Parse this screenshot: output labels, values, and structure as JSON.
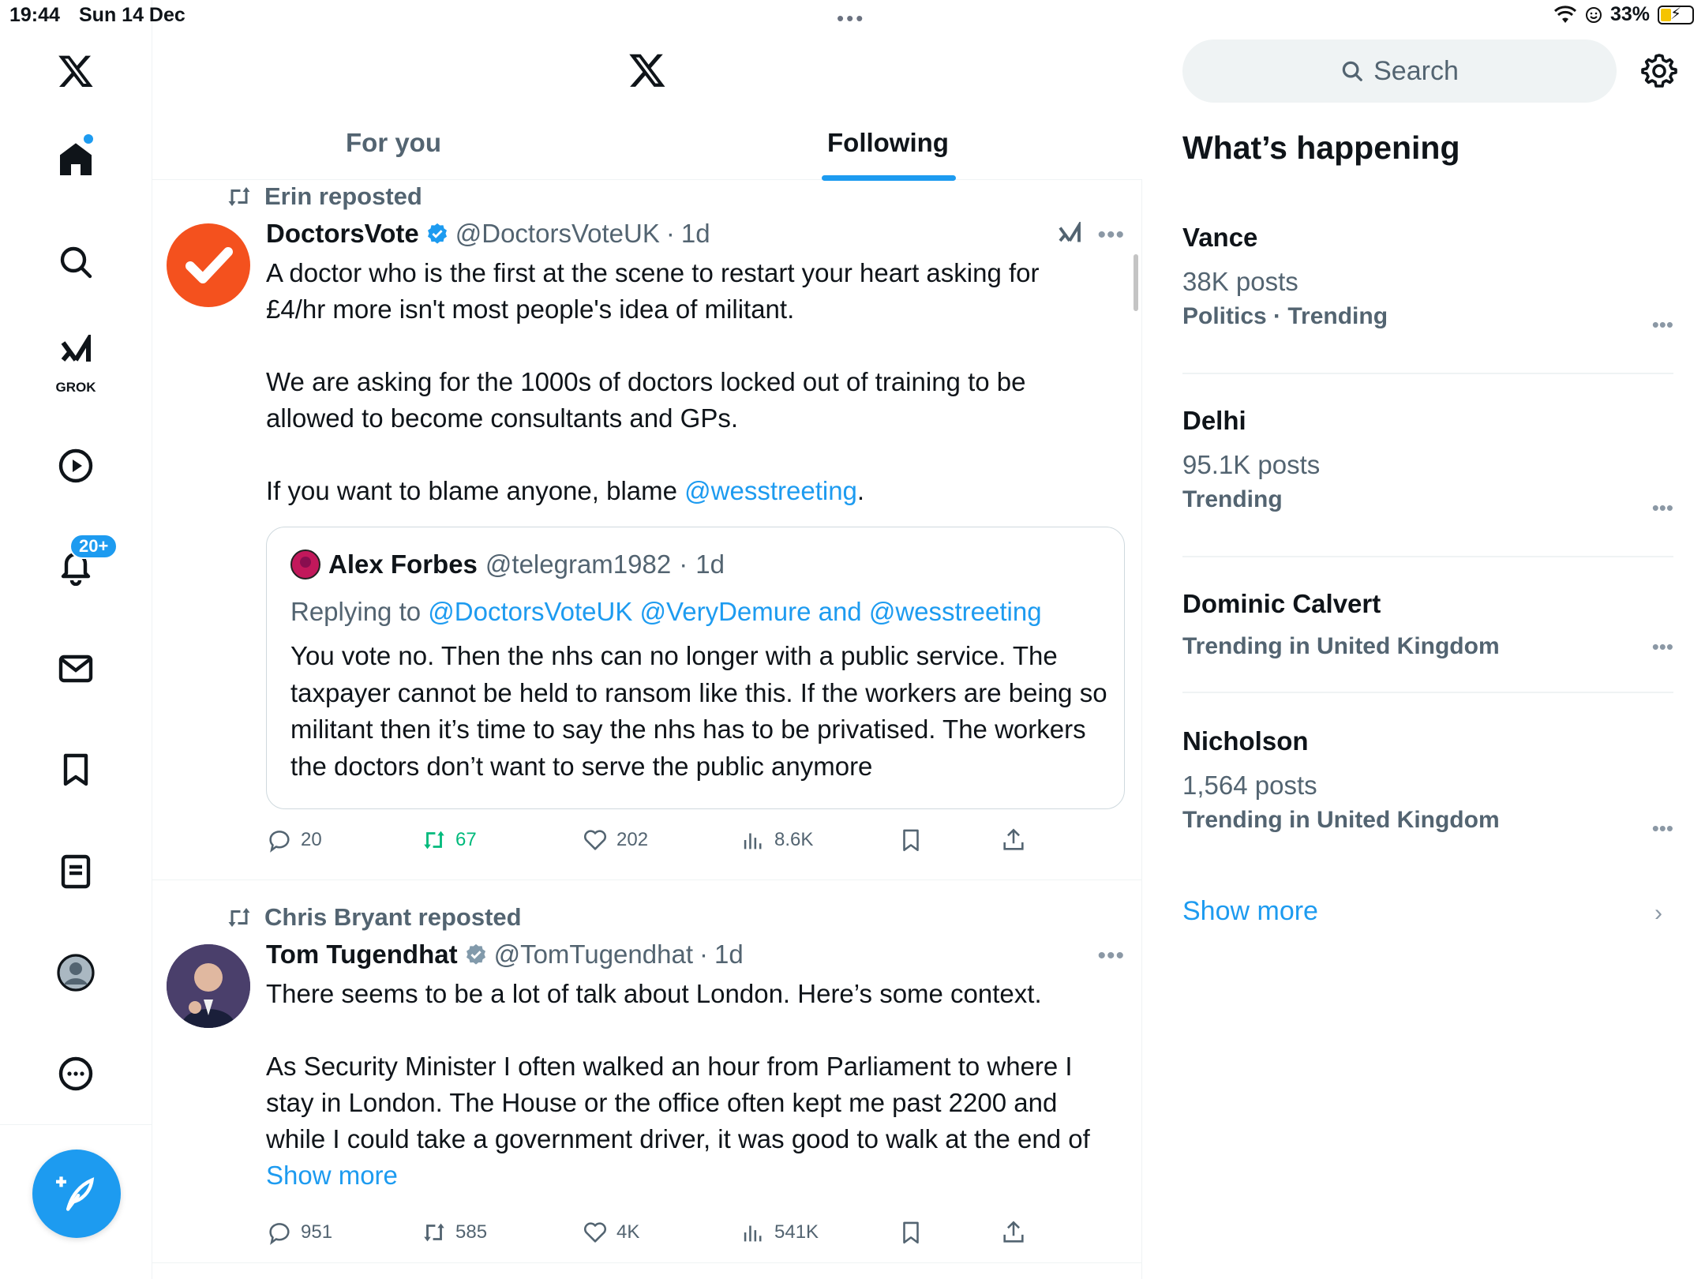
{
  "status_bar": {
    "time": "19:44",
    "date": "Sun 14 Dec",
    "battery": "33%",
    "battery_level": 0.33
  },
  "nav": {
    "notifications_badge": "20+",
    "grok_label": "GROK",
    "items": [
      "home",
      "search",
      "grok",
      "video",
      "notifications",
      "messages",
      "bookmarks",
      "lists",
      "profile",
      "more"
    ]
  },
  "tabs": {
    "for_you": "For you",
    "following": "Following"
  },
  "tweets": [
    {
      "repost_label": "Erin reposted",
      "name": "DoctorsVote",
      "handle": "@DoctorsVoteUK",
      "time": "1d",
      "paragraphs": [
        "A doctor who is the first at the scene to restart your heart asking for £4/hr more isn't most people's idea of militant.",
        "We are asking for the 1000s of doctors locked out of training to be allowed to become consultants and GPs."
      ],
      "last_para_prefix": "If you want to blame anyone, blame ",
      "last_para_mention": "@wesstreeting",
      "last_para_suffix": ".",
      "quote": {
        "name": "Alex Forbes",
        "handle": "@telegram1982",
        "time": "1d",
        "replying_prefix": "Replying to ",
        "replying_to": "@DoctorsVoteUK @VeryDemure and @wesstreeting",
        "text": "You vote no. Then the nhs can no longer with a public service. The taxpayer cannot be held to ransom like this. If the workers are being so militant then it’s time to say the nhs has to be privatised. The workers the doctors don’t want to serve the public anymore"
      },
      "stats": {
        "replies": "20",
        "reposts": "67",
        "likes": "202",
        "views": "8.6K"
      }
    },
    {
      "repost_label": "Chris Bryant reposted",
      "name": "Tom Tugendhat",
      "handle": "@TomTugendhat",
      "time": "1d",
      "paragraphs": [
        "There seems to be a lot of talk about London. Here’s some context."
      ],
      "last_para_prefix": "As Security Minister I often walked an hour from Parliament to where I stay in London. The House or the office often kept me past 2200 and while I could take a government driver, it was good to walk at the end of ",
      "last_para_mention": "Show more",
      "last_para_suffix": "",
      "stats": {
        "replies": "951",
        "reposts": "585",
        "likes": "4K",
        "views": "541K"
      }
    }
  ],
  "sidebar": {
    "search_placeholder": "Search",
    "title": "What’s happening",
    "trends": [
      {
        "name": "Vance",
        "posts": "38K posts",
        "category": "Politics · Trending"
      },
      {
        "name": "Delhi",
        "posts": "95.1K posts",
        "category": "Trending"
      },
      {
        "name": "Dominic Calvert",
        "posts": "",
        "category": "Trending in United Kingdom"
      },
      {
        "name": "Nicholson",
        "posts": "1,564 posts",
        "category": "Trending in United Kingdom"
      }
    ],
    "show_more": "Show more"
  },
  "colors": {
    "accent": "#1d9bf0",
    "repost_green": "#00ba7c",
    "secondary_text": "#536471",
    "doctorsvote_orange": "#f4511e"
  }
}
